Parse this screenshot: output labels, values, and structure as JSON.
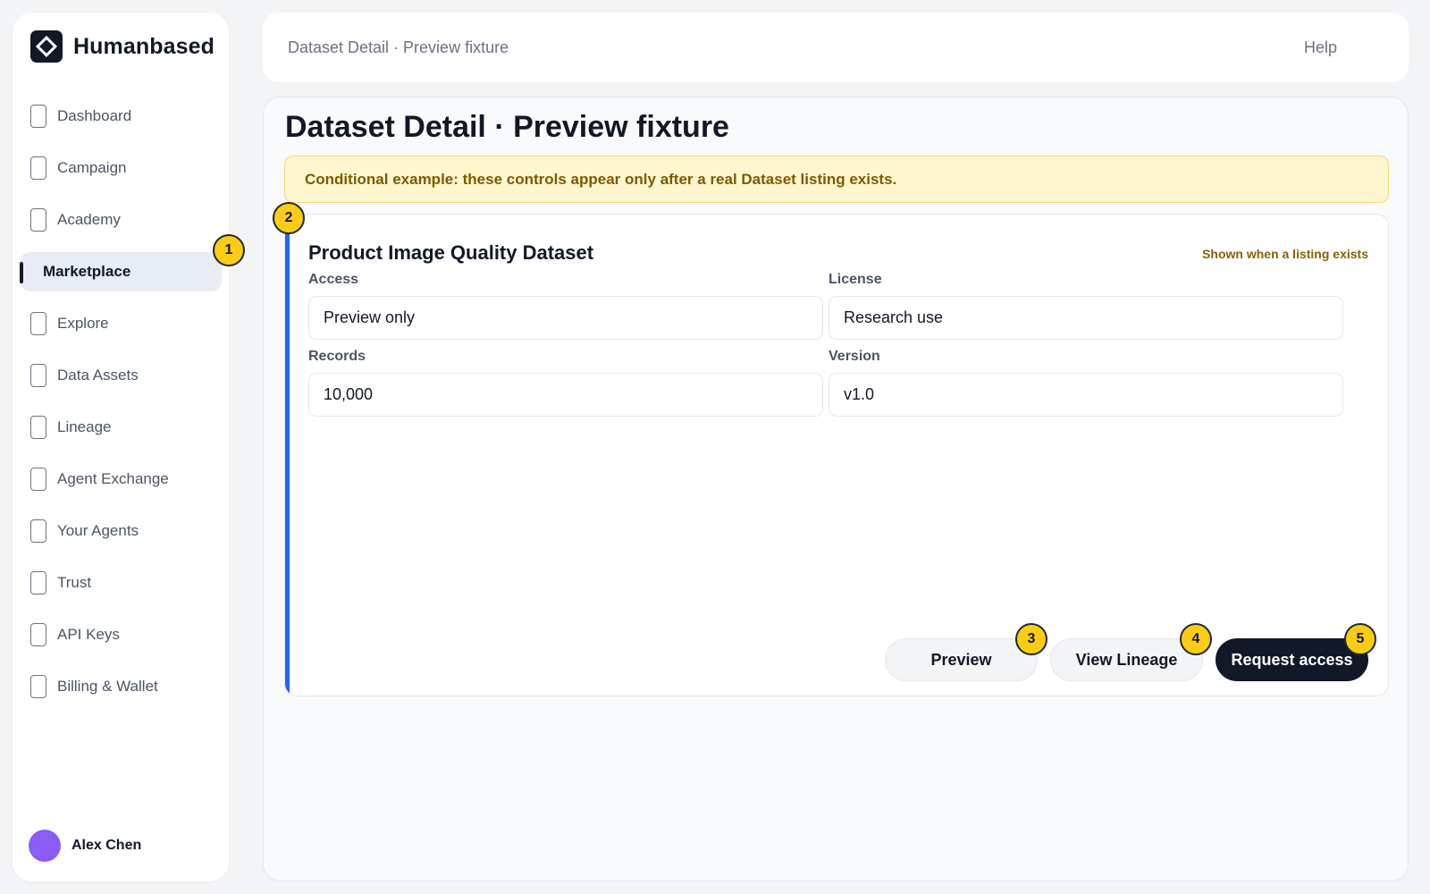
{
  "brand": {
    "name": "Humanbased"
  },
  "sidebar": {
    "items": [
      {
        "label": "Dashboard",
        "icon": "page-icon"
      },
      {
        "label": "Campaign",
        "icon": "page-icon"
      },
      {
        "label": "Academy",
        "icon": "page-icon"
      },
      {
        "label": "Marketplace",
        "active": true
      },
      {
        "label": "Explore",
        "icon": "page-icon"
      },
      {
        "label": "Data Assets",
        "icon": "page-icon"
      },
      {
        "label": "Lineage",
        "icon": "page-icon"
      },
      {
        "label": "Agent Exchange",
        "icon": "page-icon"
      },
      {
        "label": "Your Agents",
        "icon": "page-icon"
      },
      {
        "label": "Trust",
        "icon": "page-icon"
      },
      {
        "label": "API Keys",
        "icon": "page-icon"
      },
      {
        "label": "Billing & Wallet",
        "icon": "page-icon"
      }
    ],
    "user": {
      "name": "Alex Chen",
      "avatar_color": "#8b5cf6"
    }
  },
  "topbar": {
    "breadcrumb": "Dataset Detail · Preview fixture",
    "help_label": "Help"
  },
  "main": {
    "title": "Dataset Detail · Preview fixture",
    "notice": "Conditional example: these controls appear only after a real Dataset listing exists.",
    "card": {
      "title": "Product Image Quality Dataset",
      "pill": "Shown when a listing exists",
      "fields": {
        "access": {
          "label": "Access",
          "value": "Preview only"
        },
        "license": {
          "label": "License",
          "value": "Research use"
        },
        "records": {
          "label": "Records",
          "value": "10,000"
        },
        "version": {
          "label": "Version",
          "value": "v1.0"
        }
      },
      "actions": {
        "preview": "Preview",
        "lineage": "View Lineage",
        "request": "Request access"
      }
    }
  },
  "badges": [
    "1",
    "2",
    "3",
    "4",
    "5"
  ],
  "colors": {
    "accent": "#2563eb",
    "badge": "#facc15",
    "primary_button": "#111827",
    "notice_bg": "#fef6cf"
  }
}
